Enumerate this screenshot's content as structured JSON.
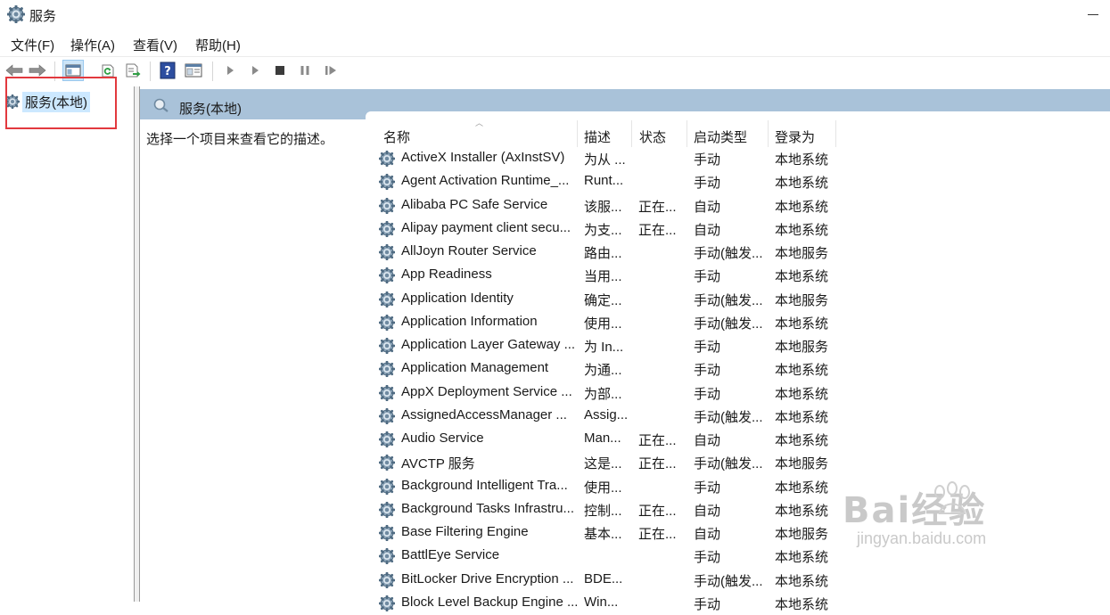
{
  "window": {
    "title": "服务"
  },
  "menu": [
    "文件(F)",
    "操作(A)",
    "查看(V)",
    "帮助(H)"
  ],
  "toolbar": [
    "back-icon",
    "forward-icon",
    "console-tree-icon",
    "refresh-icon",
    "export-list-icon",
    "help-icon",
    "properties-icon",
    "start-icon",
    "start-paused-icon",
    "stop-icon",
    "pause-icon",
    "restart-icon"
  ],
  "tree": {
    "selected_node": "服务(本地)"
  },
  "panel": {
    "header_title": "服务(本地)",
    "description_prompt": "选择一个项目来查看它的描述。"
  },
  "columns": {
    "name": "名称",
    "description": "描述",
    "status": "状态",
    "startup_type": "启动类型",
    "logon_as": "登录为"
  },
  "services": [
    {
      "name": "ActiveX Installer (AxInstSV)",
      "description": "为从 ...",
      "status": "",
      "startup": "手动",
      "logon": "本地系统"
    },
    {
      "name": "Agent Activation Runtime_...",
      "description": "Runt...",
      "status": "",
      "startup": "手动",
      "logon": "本地系统"
    },
    {
      "name": "Alibaba PC Safe Service",
      "description": "该服...",
      "status": "正在...",
      "startup": "自动",
      "logon": "本地系统"
    },
    {
      "name": "Alipay payment client secu...",
      "description": "为支...",
      "status": "正在...",
      "startup": "自动",
      "logon": "本地系统"
    },
    {
      "name": "AllJoyn Router Service",
      "description": "路由...",
      "status": "",
      "startup": "手动(触发...",
      "logon": "本地服务"
    },
    {
      "name": "App Readiness",
      "description": "当用...",
      "status": "",
      "startup": "手动",
      "logon": "本地系统"
    },
    {
      "name": "Application Identity",
      "description": "确定...",
      "status": "",
      "startup": "手动(触发...",
      "logon": "本地服务"
    },
    {
      "name": "Application Information",
      "description": "使用...",
      "status": "",
      "startup": "手动(触发...",
      "logon": "本地系统"
    },
    {
      "name": "Application Layer Gateway ...",
      "description": "为 In...",
      "status": "",
      "startup": "手动",
      "logon": "本地服务"
    },
    {
      "name": "Application Management",
      "description": "为通...",
      "status": "",
      "startup": "手动",
      "logon": "本地系统"
    },
    {
      "name": "AppX Deployment Service ...",
      "description": "为部...",
      "status": "",
      "startup": "手动",
      "logon": "本地系统"
    },
    {
      "name": "AssignedAccessManager ...",
      "description": "Assig...",
      "status": "",
      "startup": "手动(触发...",
      "logon": "本地系统"
    },
    {
      "name": "Audio Service",
      "description": "Man...",
      "status": "正在...",
      "startup": "自动",
      "logon": "本地系统"
    },
    {
      "name": "AVCTP 服务",
      "description": "这是...",
      "status": "正在...",
      "startup": "手动(触发...",
      "logon": "本地服务"
    },
    {
      "name": "Background Intelligent Tra...",
      "description": "使用...",
      "status": "",
      "startup": "手动",
      "logon": "本地系统"
    },
    {
      "name": "Background Tasks Infrastru...",
      "description": "控制...",
      "status": "正在...",
      "startup": "自动",
      "logon": "本地系统"
    },
    {
      "name": "Base Filtering Engine",
      "description": "基本...",
      "status": "正在...",
      "startup": "自动",
      "logon": "本地服务"
    },
    {
      "name": "BattlEye Service",
      "description": "",
      "status": "",
      "startup": "手动",
      "logon": "本地系统"
    },
    {
      "name": "BitLocker Drive Encryption ...",
      "description": "BDE...",
      "status": "",
      "startup": "手动(触发...",
      "logon": "本地系统"
    },
    {
      "name": "Block Level Backup Engine ...",
      "description": "Win...",
      "status": "",
      "startup": "手动",
      "logon": "本地系统"
    }
  ],
  "watermark": {
    "brand": "Bai经验",
    "url": "jingyan.baidu.com"
  },
  "colors": {
    "header_band": "#a9c2d9",
    "selection": "#cce8ff",
    "highlight_box": "#e2393e"
  }
}
